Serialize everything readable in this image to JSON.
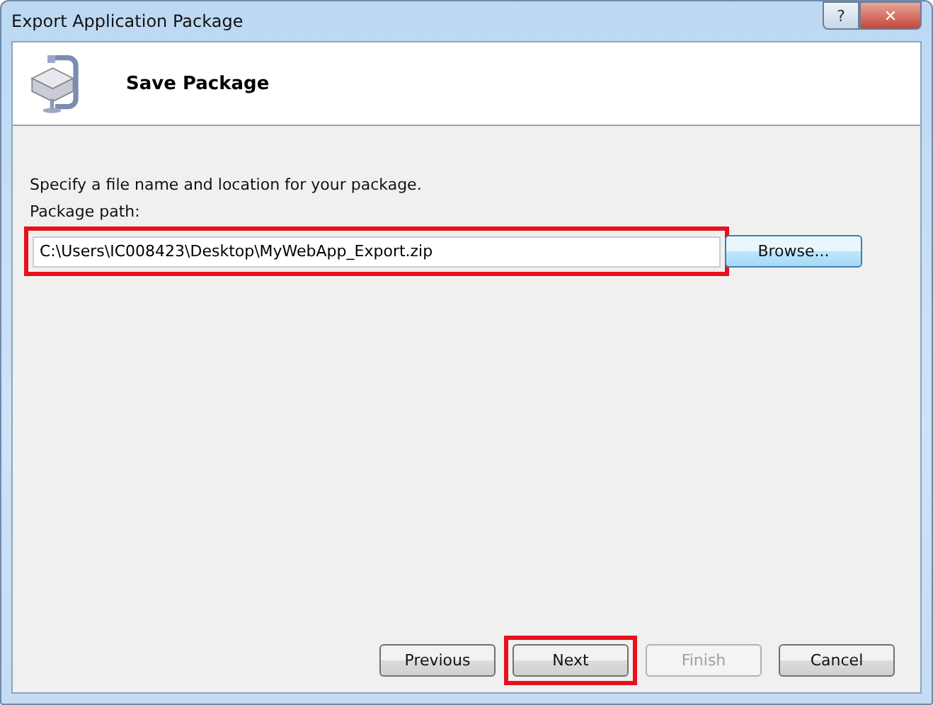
{
  "window": {
    "title": "Export Application Package",
    "controls": [
      {
        "kind": "help",
        "label": "?"
      },
      {
        "kind": "close",
        "label": "✕"
      }
    ]
  },
  "header": {
    "title": "Save Package"
  },
  "body": {
    "instruction": "Specify a file name and location for your package.",
    "path_label": "Package path:",
    "path_field": {
      "value": "C:\\Users\\IC008423\\Desktop\\MyWebApp_Export.zip",
      "highlighted": true
    },
    "browse_button": {
      "label": "Browse..."
    }
  },
  "buttons": [
    {
      "label": "Previous",
      "disabled": false,
      "highlighted": false
    },
    {
      "label": "Next",
      "disabled": false,
      "highlighted": true
    },
    {
      "label": "Finish",
      "disabled": true,
      "highlighted": false
    },
    {
      "label": "Cancel",
      "disabled": false,
      "highlighted": false
    }
  ]
}
